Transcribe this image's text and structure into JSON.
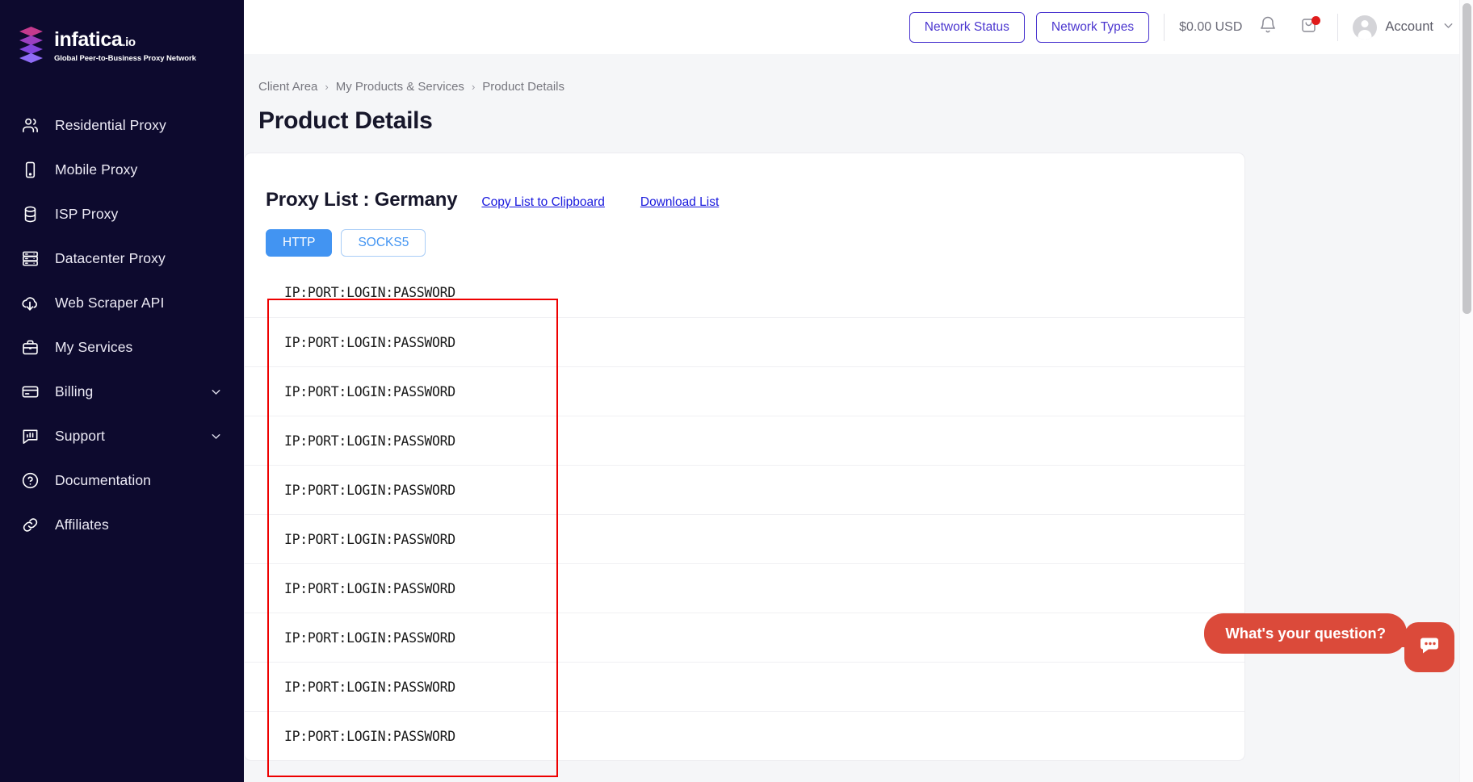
{
  "brand": {
    "name": "infatica",
    "tld": ".io",
    "tagline": "Global Peer-to-Business Proxy Network",
    "logo_colors": [
      "#e0409a",
      "#a23fc5",
      "#7b4fe0",
      "#8f6cf5"
    ],
    "sidebar_bg": "#0d0a2e"
  },
  "sidebar": {
    "items": [
      {
        "label": "Residential Proxy",
        "icon": "users-icon",
        "has_caret": false
      },
      {
        "label": "Mobile Proxy",
        "icon": "mobile-phone-icon",
        "has_caret": false
      },
      {
        "label": "ISP Proxy",
        "icon": "database-icon",
        "has_caret": false
      },
      {
        "label": "Datacenter Proxy",
        "icon": "server-rack-icon",
        "has_caret": false
      },
      {
        "label": "Web Scraper API",
        "icon": "cloud-download-icon",
        "has_caret": false
      },
      {
        "label": "My Services",
        "icon": "briefcase-icon",
        "has_caret": false
      },
      {
        "label": "Billing",
        "icon": "credit-card-icon",
        "has_caret": true
      },
      {
        "label": "Support",
        "icon": "chat-chart-icon",
        "has_caret": true
      },
      {
        "label": "Documentation",
        "icon": "question-circle-icon",
        "has_caret": false
      },
      {
        "label": "Affiliates",
        "icon": "link-chain-icon",
        "has_caret": false
      }
    ]
  },
  "header": {
    "network_status_label": "Network Status",
    "network_types_label": "Network Types",
    "balance": "$0.00 USD",
    "bell_icon": "bell-icon",
    "cart_icon": "shopping-bag-icon",
    "cart_badge_color": "#e01b1b",
    "account_label": "Account",
    "accent_color": "#4b36cf"
  },
  "breadcrumb": {
    "items": [
      "Client Area",
      "My Products & Services",
      "Product Details"
    ],
    "separator": "›"
  },
  "page": {
    "title": "Product Details"
  },
  "card": {
    "title": "Proxy List : Germany",
    "copy_link": "Copy List to Clipboard",
    "download_link": "Download List",
    "link_color": "#1818dd",
    "tabs": [
      {
        "label": "HTTP",
        "active": true
      },
      {
        "label": "SOCKS5",
        "active": false
      }
    ],
    "active_tab_color": "#4294f2",
    "proxy_entries": [
      "IP:PORT:LOGIN:PASSWORD",
      "IP:PORT:LOGIN:PASSWORD",
      "IP:PORT:LOGIN:PASSWORD",
      "IP:PORT:LOGIN:PASSWORD",
      "IP:PORT:LOGIN:PASSWORD",
      "IP:PORT:LOGIN:PASSWORD",
      "IP:PORT:LOGIN:PASSWORD",
      "IP:PORT:LOGIN:PASSWORD",
      "IP:PORT:LOGIN:PASSWORD",
      "IP:PORT:LOGIN:PASSWORD"
    ]
  },
  "annotation": {
    "color": "#ee0000"
  },
  "chat": {
    "prompt": "What's your question?",
    "color": "#db4a3a",
    "icon": "chat-dots-icon"
  }
}
